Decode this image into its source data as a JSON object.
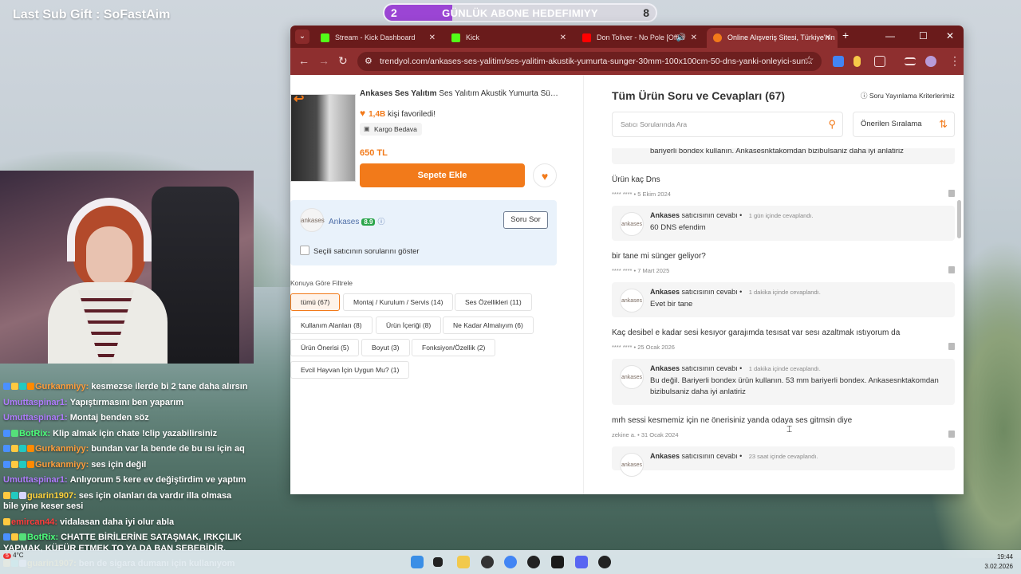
{
  "overlay": {
    "last_sub": "Last Sub Gift : SoFastAim",
    "goal": {
      "current": "2",
      "target": "8",
      "label": "GÜNLÜK ABONE HEDEFIMIYY",
      "progress": 0.25,
      "fill_color": "#9b45d4"
    }
  },
  "chat": {
    "messages": [
      {
        "user": "Gurkanmiyy:",
        "text": "kesmezse ilerde bi 2 tane daha alırsın",
        "color": "#ff9d3b",
        "badges": [
          "mod",
          "crown",
          "sub",
          "hype"
        ]
      },
      {
        "user": "Umuttaspinar1:",
        "text": "Yapıştırmasını ben yaparım",
        "color": "#b07bff",
        "badges": []
      },
      {
        "user": "Umuttaspinar1:",
        "text": "Montaj benden söz",
        "color": "#b07bff",
        "badges": []
      },
      {
        "user": "BotRix:",
        "text": "Klip almak için chate !clip yazabilirsiniz",
        "color": "#4cff7a",
        "badges": [
          "mod",
          "bot"
        ]
      },
      {
        "user": "Gurkanmiyy:",
        "text": "bundan var la bende de bu ısı için aq",
        "color": "#ff9d3b",
        "badges": [
          "mod",
          "crown",
          "sub",
          "hype"
        ]
      },
      {
        "user": "Gurkanmiyy:",
        "text": "ses için değil",
        "color": "#ff9d3b",
        "badges": [
          "mod",
          "crown",
          "sub",
          "hype"
        ]
      },
      {
        "user": "Umuttaspinar1:",
        "text": "Anlıyorum 5 kere ev değiştirdim ve yaptım",
        "color": "#b07bff",
        "badges": []
      },
      {
        "user": "guarin1907:",
        "text": "ses için olanları da vardır illa olmasa bile yine keser sesi",
        "color": "#ffd23b",
        "badges": [
          "crown",
          "sub",
          "moon"
        ],
        "wrap": true
      },
      {
        "user": "emircan44:",
        "text": "vidalasan daha iyi olur abla",
        "color": "#ff3b3b",
        "badges": [
          "crown"
        ]
      },
      {
        "user": "BotRix:",
        "text": "CHATTE BİRİLERİNE SATAŞMAK, IRKÇILIK YAPMAK, KÜFÜR ETMEK TO YA DA BAN SEBEBİDİR.",
        "color": "#4cff7a",
        "badges": [
          "mod",
          "crown",
          "bot"
        ],
        "wrap": true
      },
      {
        "user": "guarin1907:",
        "text": "ben de sigara dumanı için kullanıyom",
        "color": "#ffd23b",
        "badges": [
          "crown",
          "sub",
          "moon"
        ]
      }
    ]
  },
  "browser": {
    "tabs": [
      {
        "label": "Stream - Kick Dashboard",
        "favicon_color": "#53fc18"
      },
      {
        "label": "Kick",
        "favicon_color": "#53fc18"
      },
      {
        "label": "Don Toliver - No Pole [Offici",
        "favicon_color": "#ff0000"
      },
      {
        "label": "Online Alışveriş Sitesi, Türkiye'nin",
        "favicon_color": "#f27a1a"
      }
    ],
    "url": "trendyol.com/ankases-ses-yalitim/ses-yalitim-akustik-yumurta-sunger-30mm-100x100cm-50-dns-yanki-onleyici-sun..."
  },
  "product": {
    "brand": "Ankases Ses Yalıtım",
    "name": "Ses Yalıtım Akustik Yumurta Sünger ...",
    "fav_count": "1,4B",
    "fav_suffix": "kişi favoriledi!",
    "shipping": "Kargo Bedava",
    "price": "650 TL",
    "add_to_cart": "Sepete Ekle"
  },
  "seller": {
    "logo_text": "ankases",
    "name": "Ankases",
    "score": "8.9",
    "ask_button": "Soru Sor",
    "only_seller_label": "Seçili satıcının sorularını göster"
  },
  "filters": {
    "title": "Konuya Göre Filtrele",
    "chips": [
      "tümü (67)",
      "Montaj / Kurulum / Servis (14)",
      "Ses Özellikleri (11)",
      "Kullanım Alanları (8)",
      "Ürün İçeriği (8)",
      "Ne Kadar Almalıyım (6)",
      "Ürün Önerisi (5)",
      "Boyut (3)",
      "Fonksiyon/Özellik (2)",
      "Evcil Hayvan İçin Uygun Mu? (1)"
    ]
  },
  "qa": {
    "title": "Tüm Ürün Soru ve Cevapları (67)",
    "criteria": "Soru Yayınlama Kriterlerimiz",
    "search_placeholder": "Satıcı Sorularında Ara",
    "sort_label": "Önerilen Sıralama",
    "seller_answer_label": "satıcısının cevabı",
    "top_answer": "bariyerli bondex kullanın. Ankasesnktakomdan bizibulsaniz daha iyi anlatiriz",
    "items": [
      {
        "question": "Ürün kaç Dns",
        "asker": "**** ****",
        "date": "5 Ekim 2024",
        "answer_time": "1 gün içinde cevaplandı.",
        "answer": "60 DNS efendim"
      },
      {
        "question": "bir tane mi sünger geliyor?",
        "asker": "**** ****",
        "date": "7 Mart 2025",
        "answer_time": "1 dakika içinde cevaplandı.",
        "answer": "Evet bir tane"
      },
      {
        "question": "Kaç desibel e kadar sesi kesıyor garajımda tesısat var sesı azaltmak ıstıyorum da",
        "asker": "**** ****",
        "date": "25 Ocak 2026",
        "answer_time": "1 dakika içinde cevaplandı.",
        "answer": "Bu değil. Bariyerli bondex ürün kullanın. 53 mm bariyerli bondex. Ankasesnktakomdan bizibulsaniz daha iyi anlatiriz"
      },
      {
        "question": "mrh sessi kesmemiz için ne önerisiniz yanda odaya ses gitmsin diye",
        "asker": "zekine a.",
        "date": "31 Ocak 2024",
        "answer_time": "23 saat içinde cevaplandı.",
        "answer": ""
      }
    ]
  },
  "taskbar": {
    "weather": "4°C",
    "notif_count": "5",
    "time": "19:44",
    "date": "3.02.2026"
  }
}
